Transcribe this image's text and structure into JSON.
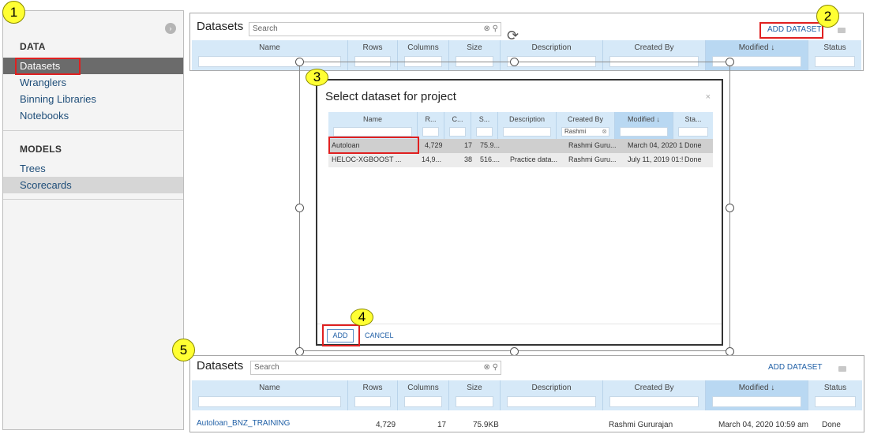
{
  "callouts": [
    "1",
    "2",
    "3",
    "4",
    "5"
  ],
  "sidebar": {
    "data_section": "DATA",
    "models_section": "MODELS",
    "items": [
      {
        "label": "Datasets"
      },
      {
        "label": "Wranglers"
      },
      {
        "label": "Binning Libraries"
      },
      {
        "label": "Notebooks"
      }
    ],
    "model_items": [
      {
        "label": "Trees"
      },
      {
        "label": "Scorecards"
      }
    ]
  },
  "top_panel": {
    "title": "Datasets",
    "search_placeholder": "Search",
    "add_label": "ADD DATASET",
    "columns": [
      "Name",
      "Rows",
      "Columns",
      "Size",
      "Description",
      "Created By",
      "Modified",
      "Status"
    ]
  },
  "modal": {
    "title": "Select dataset for project",
    "close": "×",
    "columns": [
      "Name",
      "R...",
      "C...",
      "S...",
      "Description",
      "Created By",
      "Modified",
      "Sta..."
    ],
    "created_by_filter": "Rashmi",
    "rows": [
      {
        "name": "Autoloan",
        "rows": "4,729",
        "cols": "17",
        "size": "75.9...",
        "description": "",
        "created_by": "Rashmi Guru...",
        "modified": "March 04, 2020 1",
        "status": "Done"
      },
      {
        "name": "HELOC-XGBOOST ...",
        "rows": "14,9...",
        "cols": "38",
        "size": "516....",
        "description": "Practice data...",
        "created_by": "Rashmi Guru...",
        "modified": "July 11, 2019 01:!",
        "status": "Done"
      }
    ],
    "add_button": "ADD",
    "cancel_button": "CANCEL"
  },
  "bottom_panel": {
    "title": "Datasets",
    "search_placeholder": "Search",
    "add_label": "ADD DATASET",
    "columns": [
      "Name",
      "Rows",
      "Columns",
      "Size",
      "Description",
      "Created By",
      "Modified",
      "Status"
    ],
    "row": {
      "name": "Autoloan_BNZ_TRAINING",
      "rows": "4,729",
      "cols": "17",
      "size": "75.9KB",
      "description": "",
      "created_by": "Rashmi Gururajan",
      "modified": "March 04, 2020 10:59 am",
      "status": "Done"
    }
  },
  "colors": {
    "header_blue": "#d6e9f8",
    "link_blue": "#1f5fa6",
    "highlight_red": "#e02020",
    "callout_yellow": "#ffff33"
  }
}
